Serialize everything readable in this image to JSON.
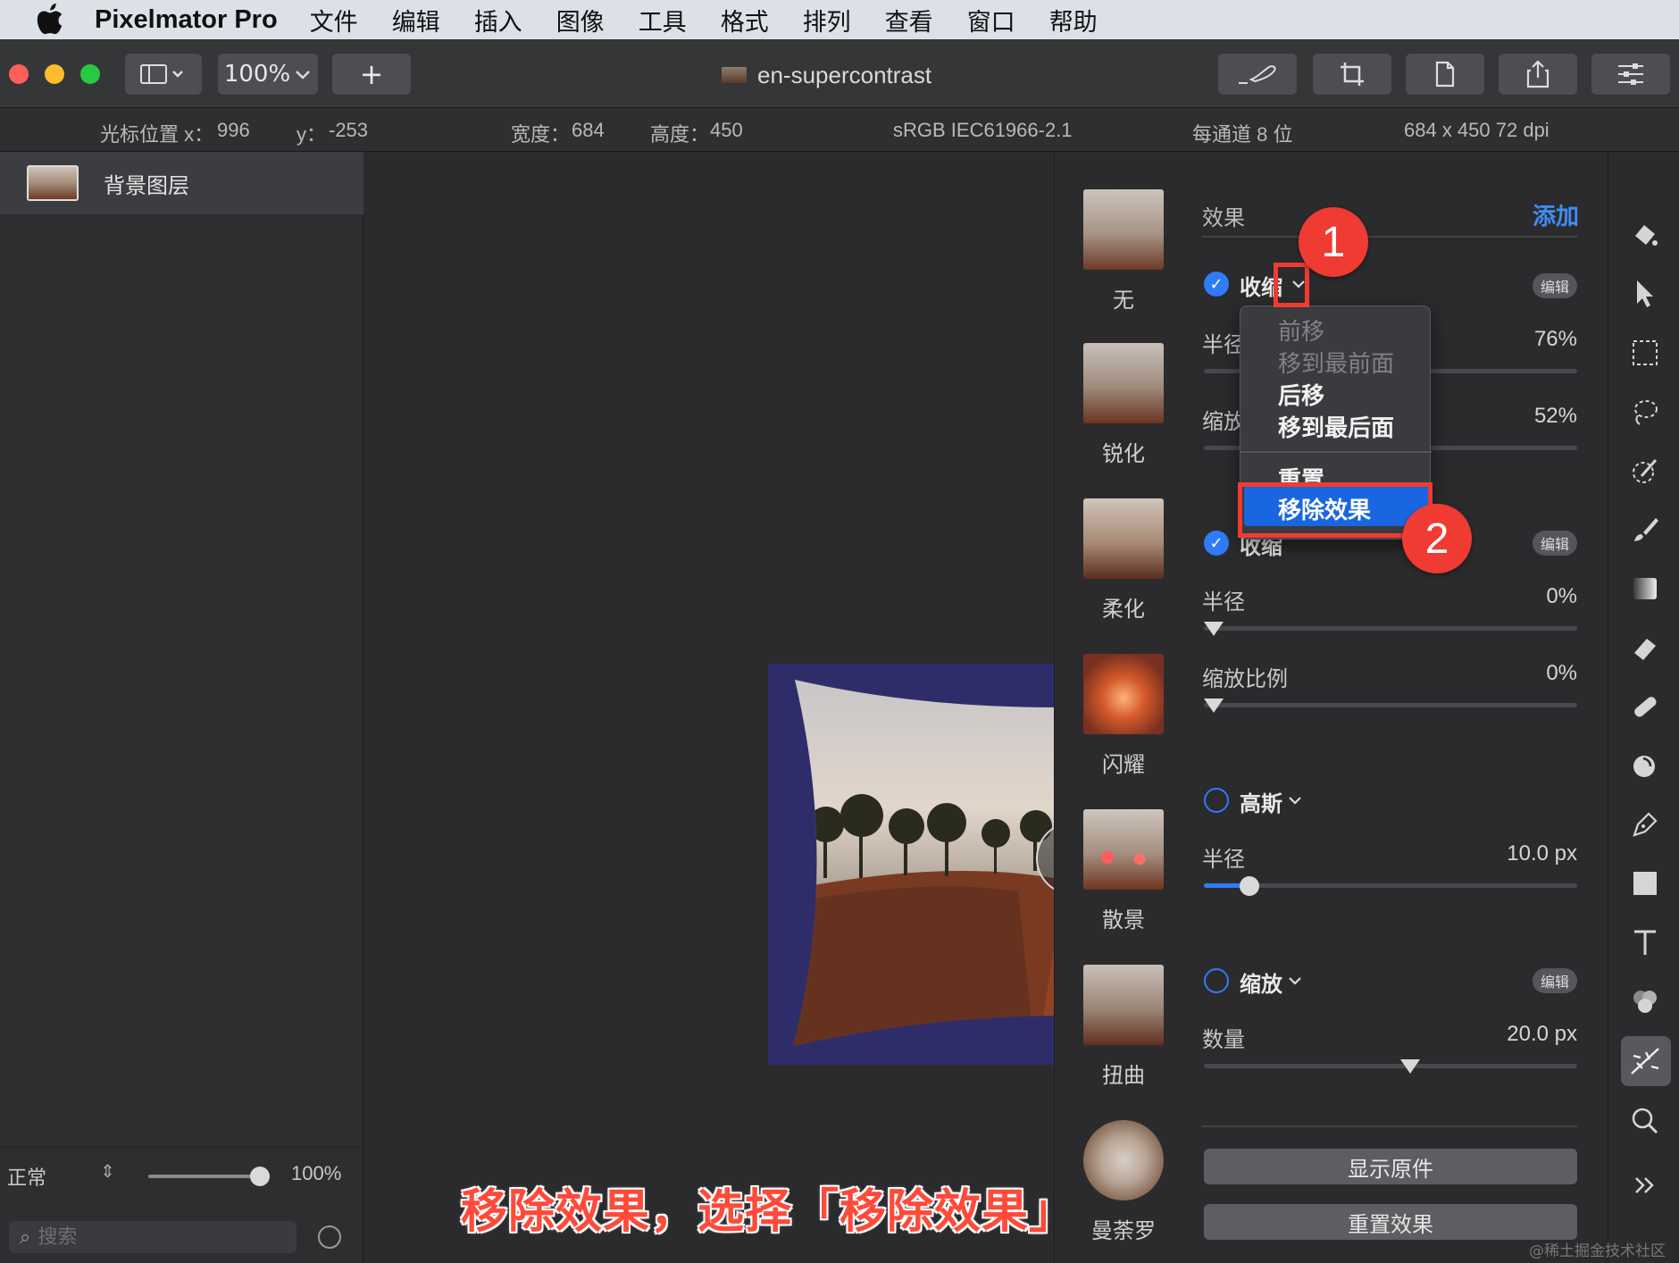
{
  "menubar": {
    "app_name": "Pixelmator Pro",
    "items": [
      "文件",
      "编辑",
      "插入",
      "图像",
      "工具",
      "格式",
      "排列",
      "查看",
      "窗口",
      "帮助"
    ]
  },
  "toolbar": {
    "zoom": "100%",
    "add_label": "+",
    "document_title": "en-supercontrast"
  },
  "infobar": {
    "cursor_x_label": "光标位置 x：",
    "cursor_x": "996",
    "cursor_y_label": "y：",
    "cursor_y": "-253",
    "width_label": "宽度：",
    "width": "684",
    "height_label": "高度：",
    "height": "450",
    "color_profile": "sRGB IEC61966-2.1",
    "bit_depth": "每通道 8 位",
    "resolution": "684 x 450 72 dpi"
  },
  "layers": {
    "items": [
      {
        "name": "背景图层"
      }
    ],
    "blend_mode": "正常",
    "opacity": "100%",
    "opacity_fraction": 1.0,
    "search_placeholder": "搜索"
  },
  "effects_browser": {
    "items": [
      {
        "label": "无"
      },
      {
        "label": "锐化"
      },
      {
        "label": "柔化"
      },
      {
        "label": "闪耀"
      },
      {
        "label": "散景"
      },
      {
        "label": "扭曲"
      },
      {
        "label": "曼荼罗"
      }
    ]
  },
  "effects_panel": {
    "title": "效果",
    "add_label": "添加",
    "edit_label": "编辑",
    "effect1": {
      "name": "收缩",
      "enabled": true,
      "params": [
        {
          "label": "半径",
          "value": "76%",
          "fraction": 0.76
        },
        {
          "label": "缩放",
          "value": "52%",
          "fraction": 0.52
        }
      ]
    },
    "effect2": {
      "name": "收缩",
      "enabled": true,
      "params": [
        {
          "label": "半径",
          "value": "0%",
          "fraction": 0.0
        },
        {
          "label": "缩放比例",
          "value": "0%",
          "fraction": 0.0
        }
      ]
    },
    "effect3": {
      "name": "高斯",
      "enabled": false,
      "params": [
        {
          "label": "半径",
          "value": "10.0 px",
          "fraction": 0.12
        }
      ]
    },
    "effect4": {
      "name": "缩放",
      "enabled": false,
      "params": [
        {
          "label": "数量",
          "value": "20.0 px",
          "fraction": 0.6
        }
      ]
    },
    "show_original_label": "显示原件",
    "reset_effects_label": "重置效果"
  },
  "context_menu": {
    "items": [
      {
        "label": "前移",
        "enabled": false
      },
      {
        "label": "移到最前面",
        "enabled": false
      },
      {
        "label": "后移",
        "enabled": true
      },
      {
        "label": "移到最后面",
        "enabled": true
      },
      {
        "label": "重置",
        "enabled": true
      },
      {
        "label": "移除效果",
        "enabled": true,
        "highlighted": true
      }
    ]
  },
  "annotations": {
    "step1": "1",
    "step2": "2",
    "caption": "移除效果，选择「移除效果」",
    "color": "#ef3b32"
  },
  "tools": [
    "paint-bucket-icon",
    "arrow-icon",
    "rect-select-icon",
    "lasso-icon",
    "magic-wand-icon",
    "brush-icon",
    "gradient-icon",
    "eraser-icon",
    "bandage-icon",
    "distort-icon",
    "pen-icon",
    "shape-icon",
    "text-icon",
    "color-adjust-icon",
    "effects-icon",
    "zoom-icon",
    "more-icon"
  ],
  "watermark": "@稀土掘金技术社区",
  "colors": {
    "accent": "#2f7cf6",
    "menu_highlight": "#1a66e0",
    "canvas_bg": "#2f2d69"
  }
}
